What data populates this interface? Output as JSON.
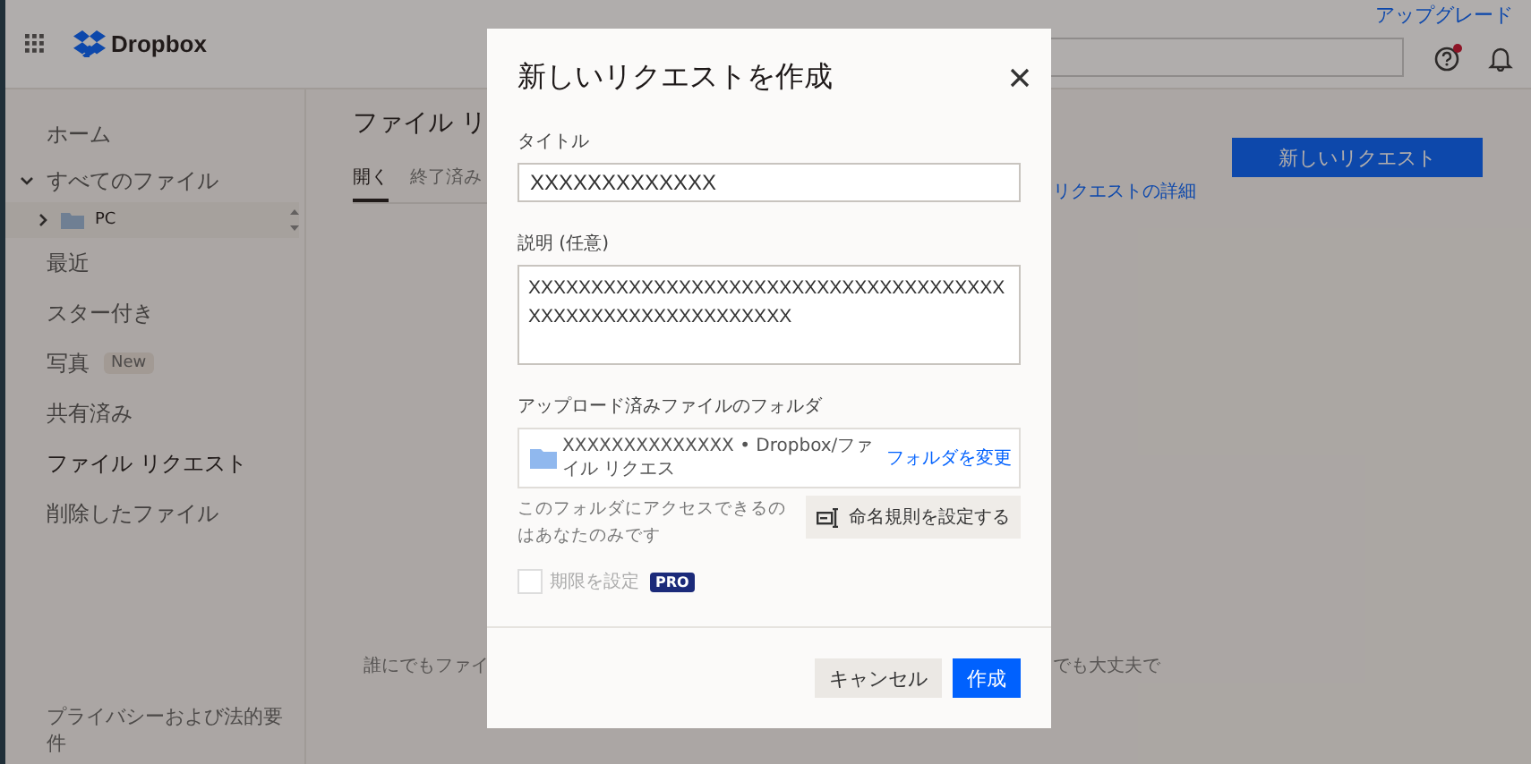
{
  "header": {
    "brand": "Dropbox",
    "upgrade_link": "アップグレード",
    "help_alert": true
  },
  "sidebar": {
    "items": [
      {
        "label": "ホーム",
        "selected": false
      },
      {
        "label": "すべてのファイル",
        "selected": false,
        "expanded": true,
        "children": [
          {
            "label": "PC",
            "expanded": false
          }
        ]
      },
      {
        "label": "最近",
        "selected": false
      },
      {
        "label": "スター付き",
        "selected": false
      },
      {
        "label": "写真",
        "selected": false,
        "badge": "New"
      },
      {
        "label": "共有済み",
        "selected": false
      },
      {
        "label": "ファイル リクエスト",
        "selected": true
      },
      {
        "label": "削除したファイル",
        "selected": false
      }
    ],
    "footer_link": "プライバシーおよび法的要件"
  },
  "page": {
    "title": "ファイル リ",
    "tabs": [
      {
        "label": "開く",
        "selected": true
      },
      {
        "label": "終了済み",
        "selected": false
      }
    ],
    "details_link": "リクエストの詳細",
    "new_request_button": "新しいリクエスト",
    "empty_text_start": "誰にでもファイ",
    "empty_text_end": "でも大丈夫で"
  },
  "dialog": {
    "title": "新しいリクエストを作成",
    "fields": [
      {
        "kind": "input",
        "label": "タイトル",
        "value": "XXXXXXXXXXXXX"
      },
      {
        "kind": "textarea",
        "label": "説明 (任意)",
        "value": "XXXXXXXXXXXXXXXXXXXXXXXXXXXXXXXXXXXXXX\nXXXXXXXXXXXXXXXXXXXXX"
      }
    ],
    "folder": {
      "label": "アップロード済みファイルのフォルダ",
      "path": "XXXXXXXXXXXXXX • Dropbox/ファイル リクエス",
      "change_link": "フォルダを変更"
    },
    "access_note": "このフォルダにアクセスできるのはあなたのみです",
    "naming_button": "命名規則を設定する",
    "deadline": {
      "label": "期限を設定",
      "checked": false,
      "disabled": true,
      "badge": "PRO"
    },
    "buttons": [
      {
        "kind": "secondary",
        "label": "キャンセル"
      },
      {
        "kind": "primary",
        "label": "作成"
      }
    ]
  }
}
